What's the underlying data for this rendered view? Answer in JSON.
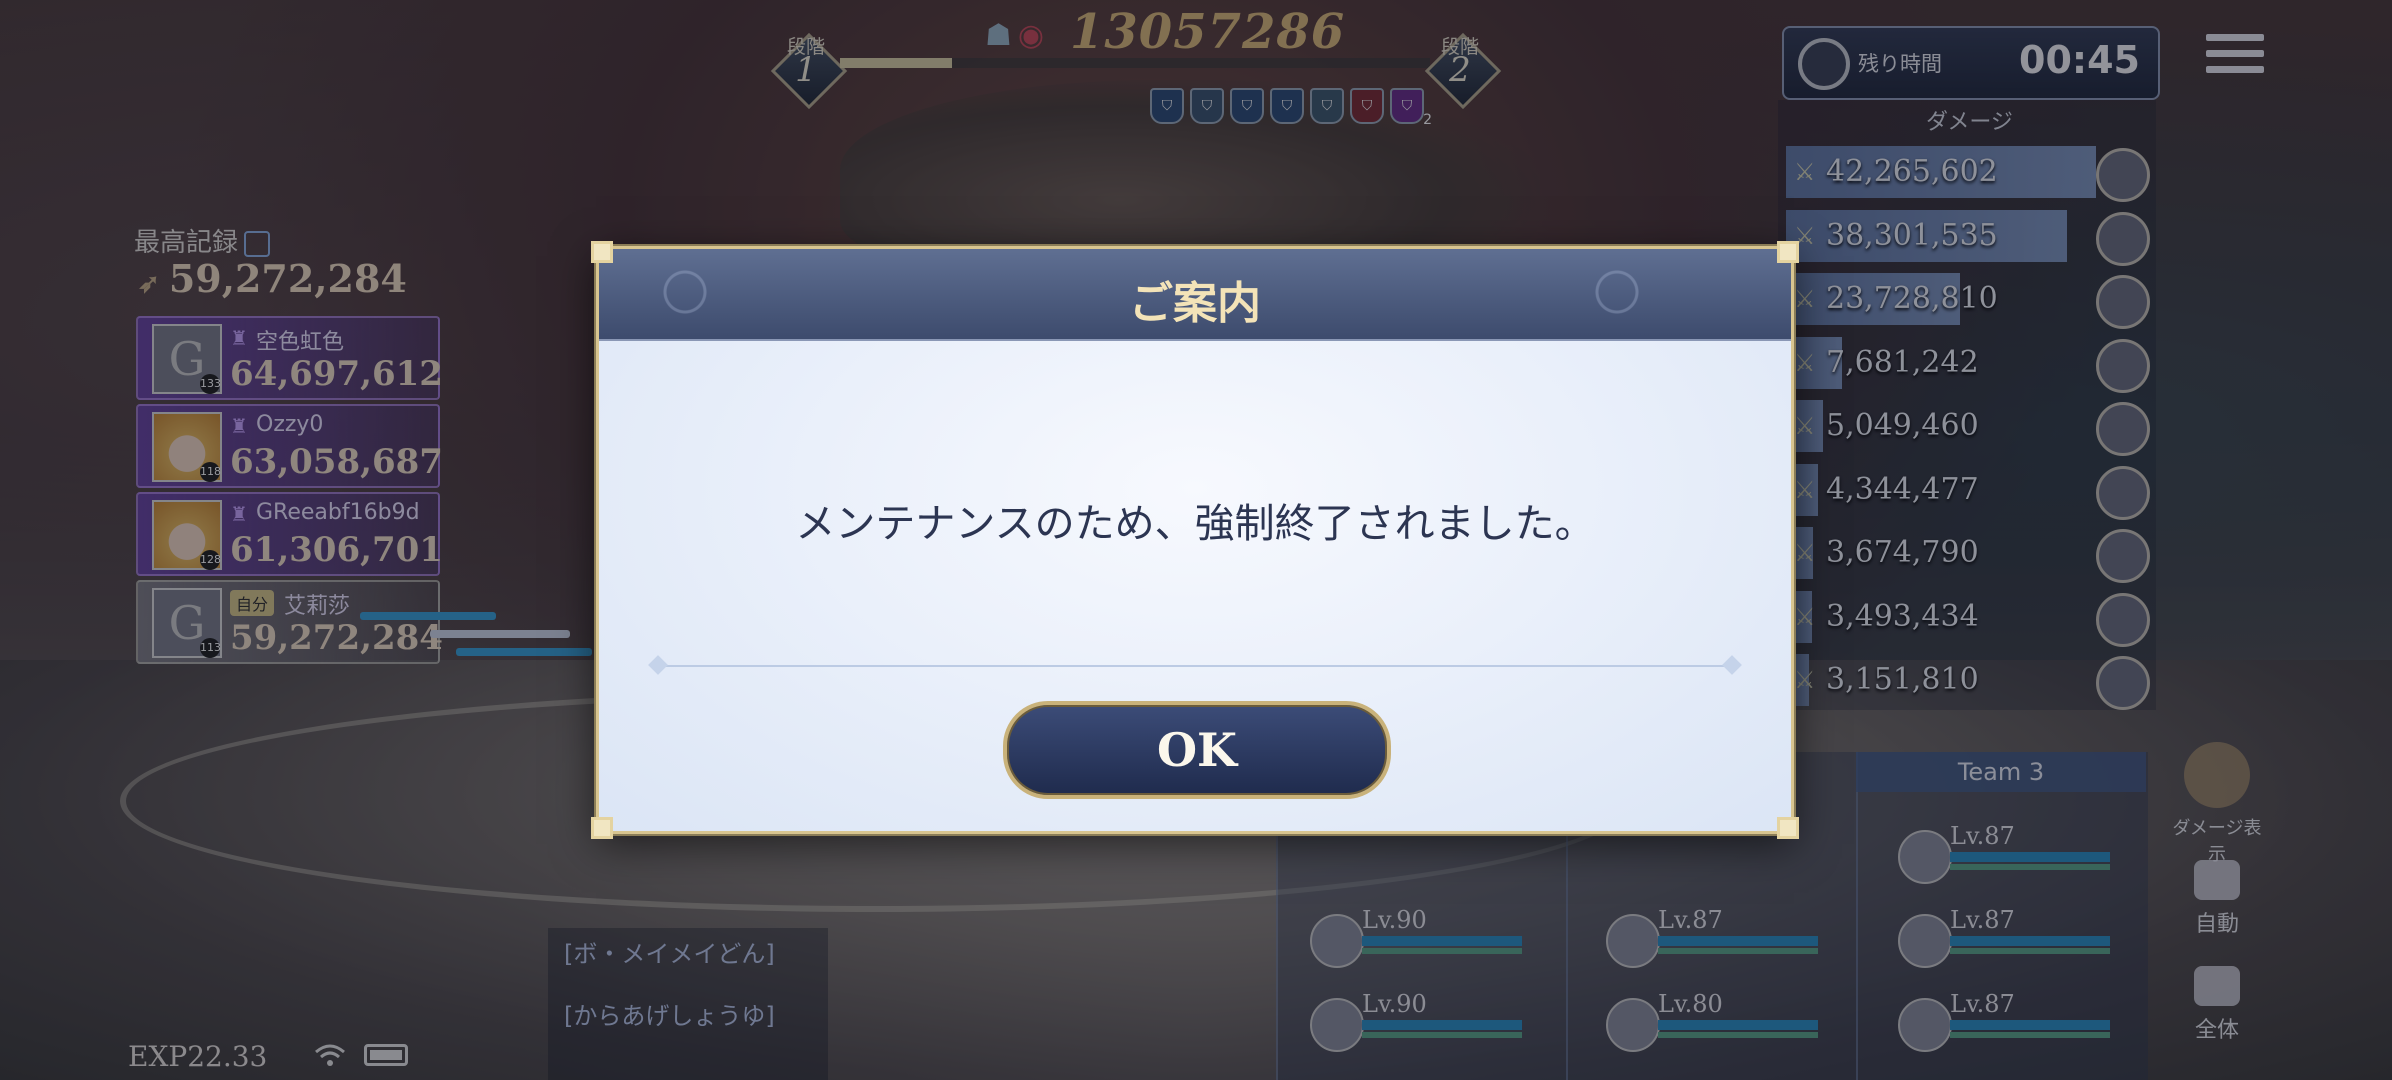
{
  "stage": {
    "current_label": "段階",
    "current_num": "1",
    "next_label": "段階",
    "next_num": "2",
    "progress_fraction": 0.19,
    "boss_score": "13057286",
    "buff_count": "2"
  },
  "timer": {
    "label": "残り時間",
    "value": "00:45"
  },
  "damage": {
    "title": "ダメージ",
    "rows": [
      {
        "value": "42,265,602",
        "fraction": 1.0
      },
      {
        "value": "38,301,535",
        "fraction": 0.906
      },
      {
        "value": "23,728,810",
        "fraction": 0.561
      },
      {
        "value": "7,681,242",
        "fraction": 0.182
      },
      {
        "value": "5,049,460",
        "fraction": 0.119
      },
      {
        "value": "4,344,477",
        "fraction": 0.103
      },
      {
        "value": "3,674,790",
        "fraction": 0.087
      },
      {
        "value": "3,493,434",
        "fraction": 0.083
      },
      {
        "value": "3,151,810",
        "fraction": 0.075
      }
    ]
  },
  "records": {
    "best_label": "最高記録",
    "best_value": "59,272,284",
    "entries": [
      {
        "name": "空色虹色",
        "score": "64,697,612",
        "level": "133",
        "avatar": "G"
      },
      {
        "name": "Ozzy0",
        "score": "63,058,687",
        "level": "118",
        "avatar": ""
      },
      {
        "name": "GReeabf16b9d",
        "score": "61,306,701",
        "level": "128",
        "avatar": ""
      },
      {
        "name": "艾莉莎",
        "score": "59,272,284",
        "level": "113",
        "avatar": "G",
        "self_tag": "自分"
      }
    ]
  },
  "status": {
    "exp": "EXP22.33"
  },
  "chat": {
    "lines": [
      "[ボ・メイメイどん]",
      "[からあげしょうゆ]"
    ]
  },
  "teams": {
    "team3_label": "Team 3",
    "team1_levels": [
      "Lv.90",
      "Lv.90"
    ],
    "team2_levels": [
      "Lv.87",
      "Lv.80"
    ],
    "team3_levels": [
      "Lv.87",
      "Lv.87",
      "Lv.87"
    ]
  },
  "side_buttons": {
    "damage_display": "ダメージ表示",
    "auto": "自動",
    "all": "全体"
  },
  "dialog": {
    "title": "ご案内",
    "message": "メンテナンスのため、強制終了されました。",
    "ok_label": "OK"
  }
}
